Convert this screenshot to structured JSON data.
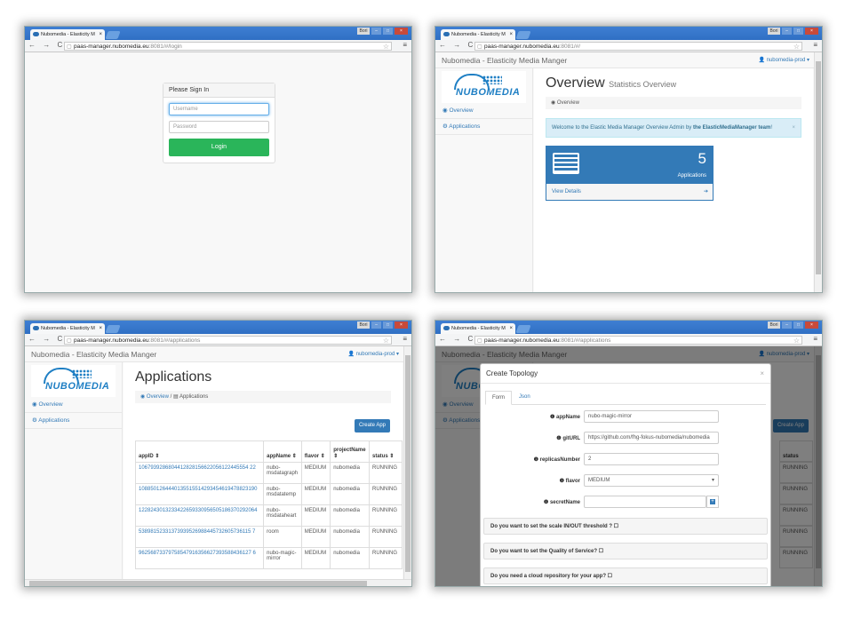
{
  "browser": {
    "tab_title": "Nubomedia - Elasticity M",
    "tab_close": "×",
    "user_label": "Bori",
    "btn_min": "–",
    "btn_max": "□",
    "btn_close": "×",
    "nav_glyphs": "← → C",
    "url_host": "paas-manager.nubomedia.eu",
    "menu_glyph": "≡",
    "star_glyph": "☆"
  },
  "urls": {
    "login": ":8081/#/login",
    "overview": ":8081/#/",
    "applications": ":8081/#/applications"
  },
  "login": {
    "panel_title": "Please Sign In",
    "username_placeholder": "Username",
    "password_placeholder": "Password",
    "button": "Login"
  },
  "app": {
    "brand": "Nubomedia - Elasticity Media Manger",
    "user": "nubomedia-prod ▾",
    "logo_text": "NUBOMEDIA",
    "sidebar": [
      "Overview",
      "Applications"
    ]
  },
  "overview": {
    "title": "Overview",
    "subtitle": "Statistics Overview",
    "crumb": "Overview",
    "alert_text": "Welcome to the Elastic Media Manager Overview Admin by ",
    "alert_bold": "the ElasticMediaManager team",
    "alert_end": "!",
    "alert_close": "×",
    "count": "5",
    "count_label": "Applications",
    "view_details": "View Details",
    "arrow": "➔"
  },
  "applications": {
    "title": "Applications",
    "crumb_home": "Overview",
    "crumb_current": "Applications",
    "create_button": "Create App",
    "columns": [
      "appID ⇕",
      "appName ⇕",
      "flavor ⇕",
      "projectName ⇕",
      "status ⇕"
    ],
    "rows": [
      [
        "1067939286804412828156622056122445554 22",
        "nubo-msdatagraph",
        "MEDIUM",
        "nubomedia",
        "RUNNING"
      ],
      [
        "1088501264440135515514293454619478823190",
        "nubo-msdatatemp",
        "MEDIUM",
        "nubomedia",
        "RUNNING"
      ],
      [
        "1228243013233422659330956505186370292064",
        "nubo-msdataheart",
        "MEDIUM",
        "nubomedia",
        "RUNNING"
      ],
      [
        "53898152331373939526988445732605736115 7",
        "room",
        "MEDIUM",
        "nubomedia",
        "RUNNING"
      ],
      [
        "96256873379758547916356627393588436127 6",
        "nubo-magic-mirror",
        "MEDIUM",
        "nubomedia",
        "RUNNING"
      ]
    ]
  },
  "modal": {
    "title": "Create Topology",
    "close": "×",
    "tabs": [
      "Form",
      "Json"
    ],
    "fields": [
      {
        "label": "❶ appName",
        "value": "nubo-magic-mirror"
      },
      {
        "label": "❶ gitURL",
        "value": "https://github.com/fhg-fokus-nubomedia/nubomedia"
      },
      {
        "label": "❶ replicasNumber",
        "value": "2"
      },
      {
        "label": "❶ flavor",
        "value": "MEDIUM"
      },
      {
        "label": "❶ secretName",
        "value": ""
      }
    ],
    "questions": [
      "Do you want to set the scale IN/OUT threshold ? ☐",
      "Do you want to set the Quality of Service? ☐",
      "Do you need a cloud repository for your app? ☐"
    ]
  },
  "bg_table": {
    "status_header": "status",
    "status_values": [
      "RUNNING",
      "RUNNING",
      "RUNNING",
      "RUNNING",
      "RUNNING"
    ],
    "create_button": "Create App"
  }
}
